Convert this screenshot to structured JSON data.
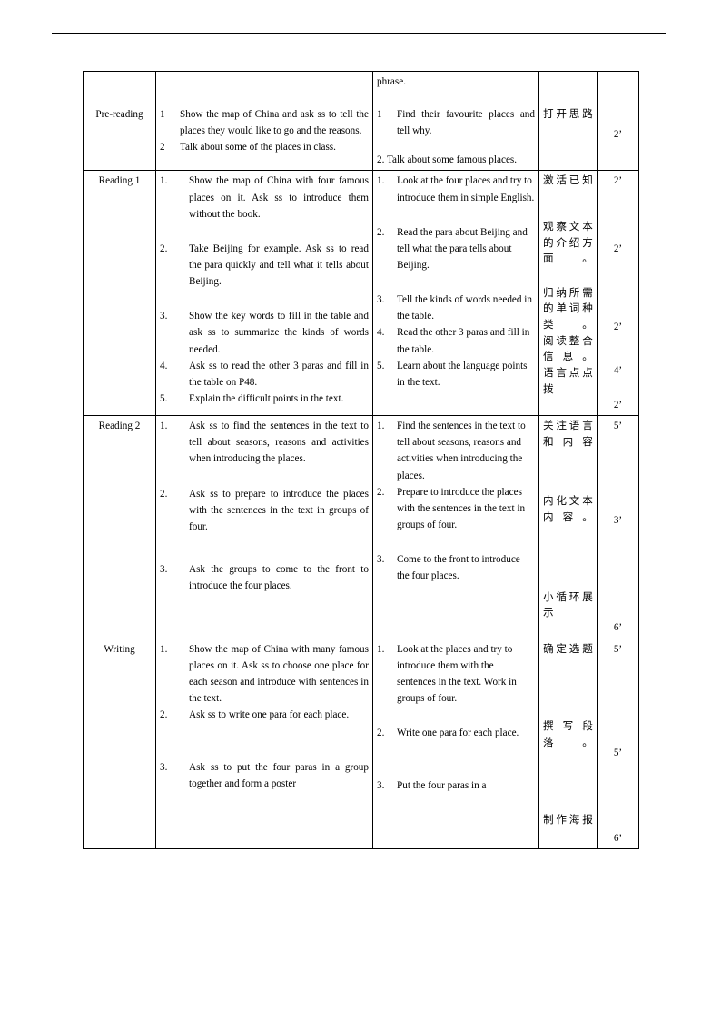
{
  "document": {
    "type": "lesson-plan-table",
    "header_rule": true
  },
  "table": {
    "rows": [
      {
        "stage": "",
        "teacher_items": [],
        "student_items": [
          {
            "num": "",
            "text": "phrase."
          }
        ],
        "intent": [],
        "time": []
      },
      {
        "stage": "Pre-reading",
        "teacher_items": [
          {
            "num": "1",
            "text": "Show the map of China and ask ss to tell the places they would like to go and the reasons."
          },
          {
            "num": "2",
            "text": "Talk about some of the places in class."
          }
        ],
        "student_items": [
          {
            "num": "1",
            "text": "Find their favourite places and tell why."
          },
          {
            "num": "2.",
            "text": "Talk about some famous places."
          }
        ],
        "intent": [
          "打开思路"
        ],
        "time": [
          "2’"
        ]
      },
      {
        "stage": "Reading 1",
        "teacher_items": [
          {
            "num": "1.",
            "text": "Show the map of China with four famous places on it. Ask ss to introduce them without the book."
          },
          {
            "num": "2.",
            "text": "Take Beijing for example. Ask ss to read the para quickly and tell what it tells about Beijing."
          },
          {
            "num": "3.",
            "text": "Show the key words to fill in the table and ask ss to summarize the kinds of words needed."
          },
          {
            "num": "4.",
            "text": "Ask ss to read the other 3 paras and fill in the table on P48."
          },
          {
            "num": "5.",
            "text": " Explain the difficult points in the text."
          }
        ],
        "student_items": [
          {
            "num": "1.",
            "text": "Look at the four places and try to introduce them in simple English."
          },
          {
            "num": "2.",
            "text": "Read the para about Beijing and tell what the para tells about Beijing."
          },
          {
            "num": "3.",
            "text": "Tell the kinds of words needed in the table."
          },
          {
            "num": "4.",
            "text": "Read the other 3 paras and fill in the table."
          },
          {
            "num": "5.",
            "text": "Learn about the language points in the text."
          }
        ],
        "intent": [
          "激活已知",
          "观察文本的介绍方面。",
          "归纳所需的单词种类。",
          "阅读整合信息。",
          "语言点点拨"
        ],
        "time": [
          "2’",
          "2’",
          "2’",
          "4’",
          "2’"
        ]
      },
      {
        "stage": "Reading 2",
        "teacher_items": [
          {
            "num": "1.",
            "text": "Ask ss to find the sentences in the text to tell about seasons, reasons and activities when introducing the places."
          },
          {
            "num": "2.",
            "text": "Ask ss to prepare to introduce the places with the sentences in the text in groups of four."
          },
          {
            "num": "3.",
            "text": "Ask the groups to come to the front to introduce the four places."
          }
        ],
        "student_items": [
          {
            "num": "1.",
            "text": "Find the sentences in the text to tell about seasons, reasons and activities when introducing the places."
          },
          {
            "num": "2.",
            "text": "Prepare to introduce the places with the sentences in the text in groups of four."
          },
          {
            "num": "3.",
            "text": "Come to the front to introduce the four places."
          }
        ],
        "intent": [
          "关注语言和内容",
          "内化文本内容。",
          "小循环展示"
        ],
        "time": [
          "5’",
          "3’",
          "6’"
        ]
      },
      {
        "stage": "Writing",
        "teacher_items": [
          {
            "num": "1.",
            "text": "Show the map of China with many famous places on it. Ask ss to choose one place for each season and introduce with sentences in the text."
          },
          {
            "num": "2.",
            "text": "Ask ss to write one para for each place."
          },
          {
            "num": "3.",
            "text": "Ask ss to put the four paras in a group together and form a poster"
          }
        ],
        "student_items": [
          {
            "num": "1.",
            "text": "Look at the places and try to introduce them with the sentences in the text. Work in groups of four."
          },
          {
            "num": "2.",
            "text": "Write one para for each place."
          },
          {
            "num": "3.",
            "text": "Put the four paras in a"
          }
        ],
        "intent": [
          "确定选题",
          "撰写段落。",
          "制作海报"
        ],
        "time": [
          "5’",
          "5’",
          "6’"
        ]
      }
    ]
  }
}
